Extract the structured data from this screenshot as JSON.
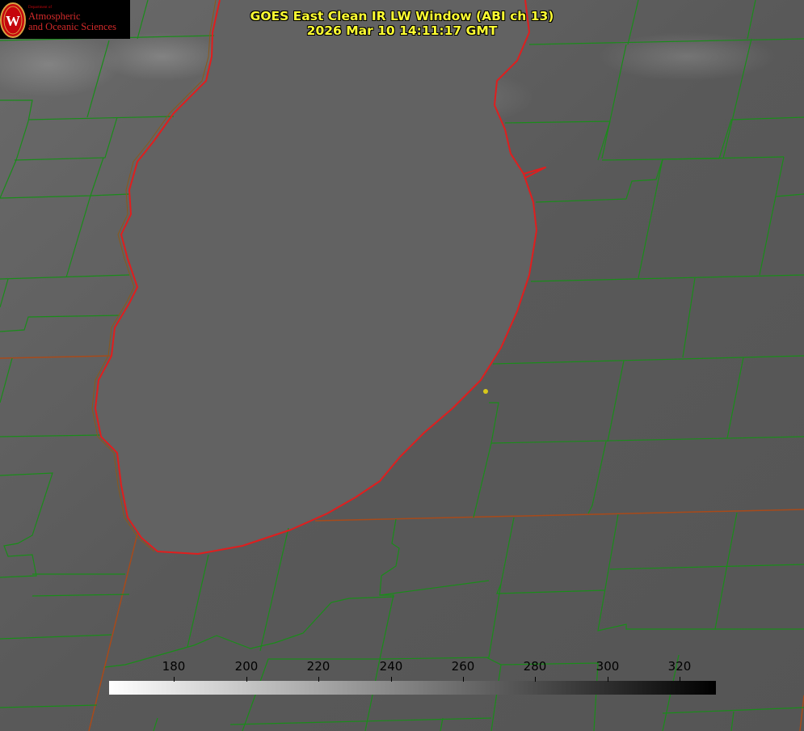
{
  "title": {
    "line1": "GOES East Clean IR LW Window (ABI ch 13)",
    "line2": "2026 Mar 10 14:11:17 GMT"
  },
  "logo": {
    "dept": "Department of",
    "line1": "Atmospheric",
    "line2": "and Oceanic Sciences",
    "crest_letter": "W"
  },
  "colorbar": {
    "min": 162,
    "max": 330,
    "ticks": [
      {
        "value": 180,
        "label": "180"
      },
      {
        "value": 200,
        "label": "200"
      },
      {
        "value": 220,
        "label": "220"
      },
      {
        "value": 240,
        "label": "240"
      },
      {
        "value": 260,
        "label": "260"
      },
      {
        "value": 280,
        "label": "280"
      },
      {
        "value": 300,
        "label": "300"
      },
      {
        "value": 320,
        "label": "320"
      }
    ],
    "low_color": "#ffffff",
    "high_color": "#000000"
  },
  "colors": {
    "land": "#5a5a5a",
    "lake": "#626262",
    "county_lines": "#1a8c1a",
    "coastline": "#e01e1e",
    "state_lines": "#a84a1a",
    "marker": "#d8c81a",
    "title_text": "#ffff33"
  },
  "icons": {
    "logo_crest": "uw-crest-icon",
    "location_marker": "location-dot-icon"
  }
}
